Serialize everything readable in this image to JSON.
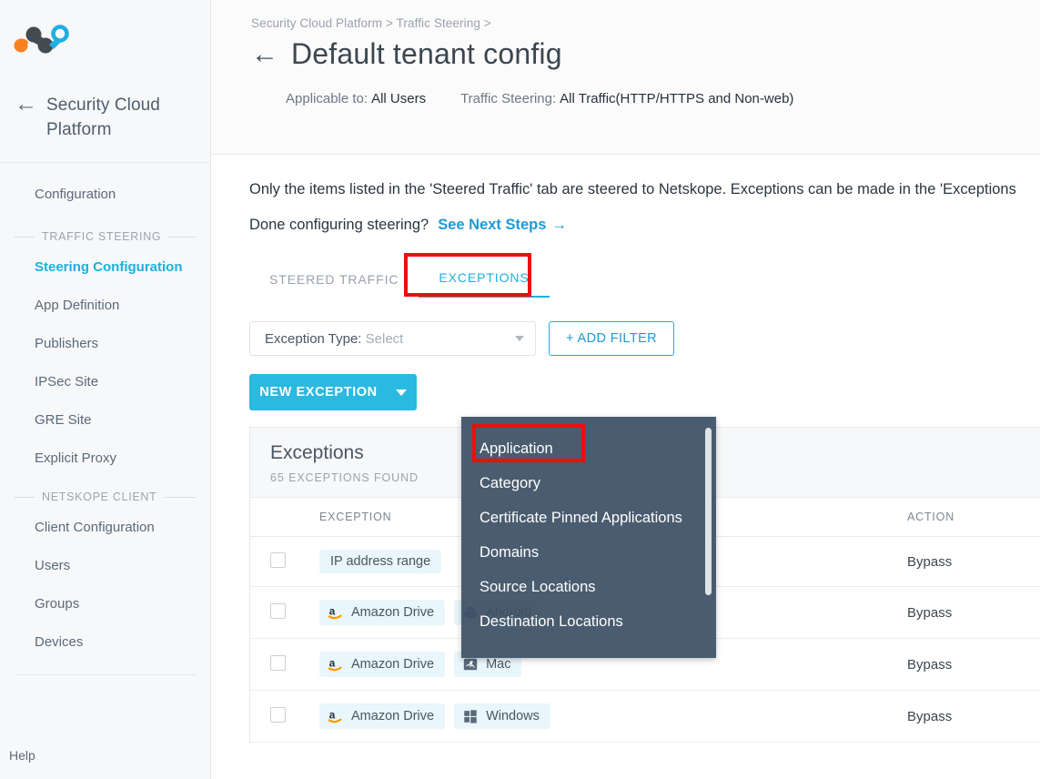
{
  "sidebar": {
    "logo_name": "netskope-logo",
    "brand": {
      "back_icon": "←",
      "title": "Security Cloud Platform"
    },
    "top_items": [
      {
        "label": "Configuration",
        "active": false
      }
    ],
    "sections": [
      {
        "heading": "TRAFFIC STEERING",
        "items": [
          {
            "label": "Steering Configuration",
            "active": true
          },
          {
            "label": "App Definition",
            "active": false
          },
          {
            "label": "Publishers",
            "active": false
          },
          {
            "label": "IPSec Site",
            "active": false
          },
          {
            "label": "GRE Site",
            "active": false
          },
          {
            "label": "Explicit Proxy",
            "active": false
          }
        ]
      },
      {
        "heading": "NETSKOPE CLIENT",
        "items": [
          {
            "label": "Client Configuration",
            "active": false
          },
          {
            "label": "Users",
            "active": false
          },
          {
            "label": "Groups",
            "active": false
          },
          {
            "label": "Devices",
            "active": false
          }
        ]
      }
    ],
    "help_label": "Help"
  },
  "header": {
    "breadcrumb": "Security Cloud Platform > Traffic Steering >",
    "back_icon": "←",
    "title": "Default tenant config",
    "meta": [
      {
        "label": "Applicable to:",
        "value": "All Users"
      },
      {
        "label": "Traffic Steering:",
        "value": "All Traffic(HTTP/HTTPS and Non-web)"
      }
    ]
  },
  "content": {
    "description": "Only the items listed in the 'Steered Traffic' tab are steered to Netskope. Exceptions can be made in the 'Exceptions",
    "done_prompt": "Done configuring steering?",
    "next_steps_link": "See Next Steps",
    "next_steps_arrow": "→",
    "tabs": [
      {
        "label": "STEERED TRAFFIC",
        "active": false,
        "highlighted": false
      },
      {
        "label": "EXCEPTIONS",
        "active": true,
        "highlighted": true
      }
    ],
    "filter": {
      "select_label": "Exception Type:",
      "select_value": "Select",
      "caret_icon": "chevron-down-icon",
      "add_filter_label": "+ ADD FILTER"
    },
    "new_exception": {
      "label": "NEW EXCEPTION",
      "caret_icon": "chevron-down-icon",
      "accent": "#2ab9e0",
      "menu_items": [
        {
          "label": "Application",
          "highlighted": true
        },
        {
          "label": "Category",
          "highlighted": false
        },
        {
          "label": "Certificate Pinned Applications",
          "highlighted": false
        },
        {
          "label": "Domains",
          "highlighted": false
        },
        {
          "label": "Source Locations",
          "highlighted": false
        },
        {
          "label": "Destination Locations",
          "highlighted": false
        }
      ]
    },
    "panel": {
      "title": "Exceptions",
      "count_label": "65 EXCEPTIONS FOUND",
      "columns": [
        "",
        "EXCEPTION",
        "ACTION"
      ],
      "rows": [
        {
          "checked": false,
          "chips": [
            {
              "label": "IP address range",
              "icon": ""
            }
          ],
          "action": "Bypass"
        },
        {
          "checked": false,
          "chips": [
            {
              "label": "Amazon Drive",
              "icon": "amazon-icon"
            },
            {
              "label": "Android",
              "icon": "android-icon"
            }
          ],
          "action": "Bypass"
        },
        {
          "checked": false,
          "chips": [
            {
              "label": "Amazon Drive",
              "icon": "amazon-icon"
            },
            {
              "label": "Mac",
              "icon": "mac-icon"
            }
          ],
          "action": "Bypass"
        },
        {
          "checked": false,
          "chips": [
            {
              "label": "Amazon Drive",
              "icon": "amazon-icon"
            },
            {
              "label": "Windows",
              "icon": "windows-icon"
            }
          ],
          "action": "Bypass"
        }
      ]
    }
  },
  "colors": {
    "accent": "#2ab9e0",
    "link": "#1e9ad6",
    "annotation": "#ef0d0d",
    "menu_bg": "#3c5064",
    "sidebar_bg": "#f7f8f9"
  }
}
